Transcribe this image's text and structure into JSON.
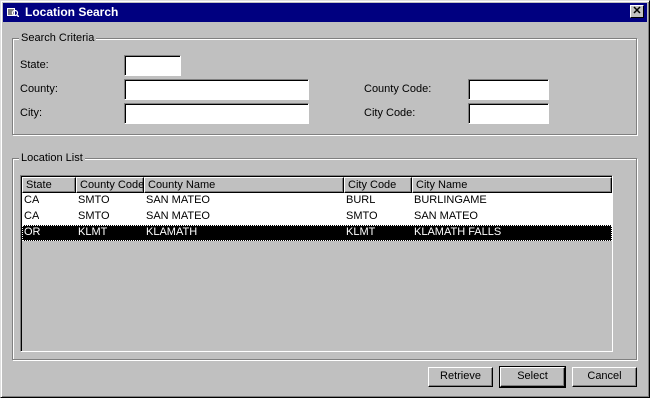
{
  "window": {
    "title": "Location Search"
  },
  "criteria": {
    "legend": "Search Criteria",
    "state_label": "State:",
    "county_label": "County:",
    "city_label": "City:",
    "county_code_label": "County Code:",
    "city_code_label": "City Code:",
    "state_value": "",
    "county_value": "",
    "city_value": "",
    "county_code_value": "",
    "city_code_value": ""
  },
  "list": {
    "legend": "Location List",
    "columns": [
      "State",
      "County Code",
      "County Name",
      "City Code",
      "City Name"
    ],
    "rows": [
      [
        "CA",
        "SMTO",
        "SAN MATEO",
        "BURL",
        "BURLINGAME"
      ],
      [
        "CA",
        "SMTO",
        "SAN MATEO",
        "SMTO",
        "SAN MATEO"
      ],
      [
        "OR",
        "KLMT",
        "KLAMATH",
        "KLMT",
        "KLAMATH FALLS"
      ]
    ],
    "selected_index": 2
  },
  "buttons": {
    "retrieve_label": "Retrieve",
    "select_label": "Select",
    "cancel_label": "Cancel"
  },
  "icons": {
    "title": "search-window-icon",
    "close": "close-icon"
  }
}
